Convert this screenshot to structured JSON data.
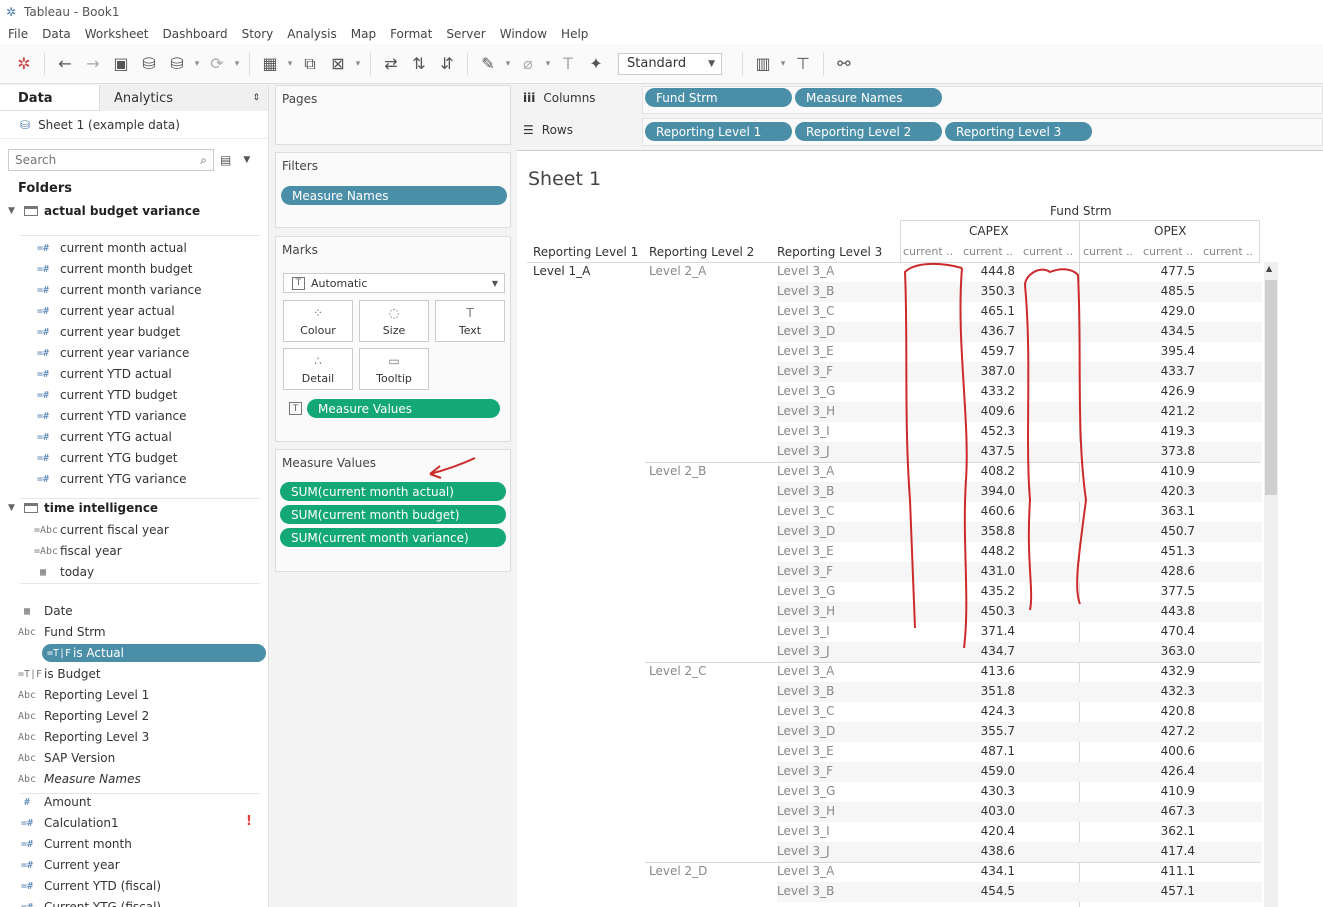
{
  "window": {
    "title": "Tableau - Book1"
  },
  "menu": [
    "File",
    "Data",
    "Worksheet",
    "Dashboard",
    "Story",
    "Analysis",
    "Map",
    "Format",
    "Server",
    "Window",
    "Help"
  ],
  "toolbar": {
    "view_select": "Standard"
  },
  "data_pane": {
    "tab_data": "Data",
    "tab_analytics": "Analytics",
    "source": "Sheet 1 (example data)",
    "search_placeholder": "Search",
    "folders_title": "Folders",
    "folder1": {
      "name": "actual budget variance",
      "fields": [
        "current month actual",
        "current month budget",
        "current month variance",
        "current year actual",
        "current year budget",
        "current year variance",
        "current YTD actual",
        "current YTD budget",
        "current YTD variance",
        "current YTG actual",
        "current YTG budget",
        "current YTG variance"
      ]
    },
    "folder2": {
      "name": "time intelligence",
      "fields": [
        {
          "icon": "=Abc",
          "name": "current fiscal year"
        },
        {
          "icon": "=Abc",
          "name": "fiscal year"
        },
        {
          "icon": "cal",
          "name": "today"
        }
      ]
    },
    "dimensions": [
      {
        "icon": "cal",
        "name": "Date"
      },
      {
        "icon": "Abc",
        "name": "Fund Strm"
      },
      {
        "icon": "=T|F",
        "name": "is Actual",
        "selected": true
      },
      {
        "icon": "=T|F",
        "name": "is Budget"
      },
      {
        "icon": "Abc",
        "name": "Reporting Level 1"
      },
      {
        "icon": "Abc",
        "name": "Reporting Level 2"
      },
      {
        "icon": "Abc",
        "name": "Reporting Level 3"
      },
      {
        "icon": "Abc",
        "name": "SAP Version"
      },
      {
        "icon": "Abc",
        "name": "Measure Names",
        "italic": true
      }
    ],
    "measures": [
      {
        "icon": "#",
        "name": "Amount"
      },
      {
        "icon": "=#",
        "name": "Calculation1",
        "error": "!"
      },
      {
        "icon": "=#",
        "name": "Current month"
      },
      {
        "icon": "=#",
        "name": "Current year"
      },
      {
        "icon": "=#",
        "name": "Current YTD (fiscal)"
      },
      {
        "icon": "=#",
        "name": "Current YTG (fiscal)"
      }
    ]
  },
  "shelves": {
    "pages": "Pages",
    "filters": "Filters",
    "filter_pill": "Measure Names",
    "marks": "Marks",
    "mark_type": "Automatic",
    "mark_buttons": [
      "Colour",
      "Size",
      "Text",
      "Detail",
      "Tooltip"
    ],
    "marks_pill": "Measure Values",
    "measure_values_title": "Measure Values",
    "measure_values": [
      "SUM(current month actual)",
      "SUM(current month budget)",
      "SUM(current month variance)"
    ]
  },
  "columns": {
    "label": "Columns",
    "pills": [
      "Fund Strm",
      "Measure Names"
    ]
  },
  "rows": {
    "label": "Rows",
    "pills": [
      "Reporting Level 1",
      "Reporting Level 2",
      "Reporting Level 3"
    ]
  },
  "sheet": {
    "title": "Sheet 1",
    "fund_strm_header": "Fund Strm",
    "capex": "CAPEX",
    "opex": "OPEX",
    "col_headers": [
      "Reporting Level 1",
      "Reporting Level 2",
      "Reporting Level 3"
    ],
    "measure_headers": [
      "current ..",
      "current ..",
      "current .."
    ],
    "level1": "Level 1_A",
    "groups": [
      {
        "level2": "Level 2_A",
        "rows": [
          {
            "l3": "Level 3_A",
            "capex": "444.8",
            "opex": "477.5"
          },
          {
            "l3": "Level 3_B",
            "capex": "350.3",
            "opex": "485.5"
          },
          {
            "l3": "Level 3_C",
            "capex": "465.1",
            "opex": "429.0"
          },
          {
            "l3": "Level 3_D",
            "capex": "436.7",
            "opex": "434.5"
          },
          {
            "l3": "Level 3_E",
            "capex": "459.7",
            "opex": "395.4"
          },
          {
            "l3": "Level 3_F",
            "capex": "387.0",
            "opex": "433.7"
          },
          {
            "l3": "Level 3_G",
            "capex": "433.2",
            "opex": "426.9"
          },
          {
            "l3": "Level 3_H",
            "capex": "409.6",
            "opex": "421.2"
          },
          {
            "l3": "Level 3_I",
            "capex": "452.3",
            "opex": "419.3"
          },
          {
            "l3": "Level 3_J",
            "capex": "437.5",
            "opex": "373.8"
          }
        ]
      },
      {
        "level2": "Level 2_B",
        "rows": [
          {
            "l3": "Level 3_A",
            "capex": "408.2",
            "opex": "410.9"
          },
          {
            "l3": "Level 3_B",
            "capex": "394.0",
            "opex": "420.3"
          },
          {
            "l3": "Level 3_C",
            "capex": "460.6",
            "opex": "363.1"
          },
          {
            "l3": "Level 3_D",
            "capex": "358.8",
            "opex": "450.7"
          },
          {
            "l3": "Level 3_E",
            "capex": "448.2",
            "opex": "451.3"
          },
          {
            "l3": "Level 3_F",
            "capex": "431.0",
            "opex": "428.6"
          },
          {
            "l3": "Level 3_G",
            "capex": "435.2",
            "opex": "377.5"
          },
          {
            "l3": "Level 3_H",
            "capex": "450.3",
            "opex": "443.8"
          },
          {
            "l3": "Level 3_I",
            "capex": "371.4",
            "opex": "470.4"
          },
          {
            "l3": "Level 3_J",
            "capex": "434.7",
            "opex": "363.0"
          }
        ]
      },
      {
        "level2": "Level 2_C",
        "rows": [
          {
            "l3": "Level 3_A",
            "capex": "413.6",
            "opex": "432.9"
          },
          {
            "l3": "Level 3_B",
            "capex": "351.8",
            "opex": "432.3"
          },
          {
            "l3": "Level 3_C",
            "capex": "424.3",
            "opex": "420.8"
          },
          {
            "l3": "Level 3_D",
            "capex": "355.7",
            "opex": "427.2"
          },
          {
            "l3": "Level 3_E",
            "capex": "487.1",
            "opex": "400.6"
          },
          {
            "l3": "Level 3_F",
            "capex": "459.0",
            "opex": "426.4"
          },
          {
            "l3": "Level 3_G",
            "capex": "430.3",
            "opex": "410.9"
          },
          {
            "l3": "Level 3_H",
            "capex": "403.0",
            "opex": "467.3"
          },
          {
            "l3": "Level 3_I",
            "capex": "420.4",
            "opex": "362.1"
          },
          {
            "l3": "Level 3_J",
            "capex": "438.6",
            "opex": "417.4"
          }
        ]
      },
      {
        "level2": "Level 2_D",
        "rows": [
          {
            "l3": "Level 3_A",
            "capex": "434.1",
            "opex": "411.1"
          },
          {
            "l3": "Level 3_B",
            "capex": "454.5",
            "opex": "457.1"
          }
        ]
      }
    ]
  },
  "colors": {
    "pill_blue": "#4b8ea8",
    "pill_green": "#13a875",
    "annotation_red": "#cc2a2a"
  }
}
